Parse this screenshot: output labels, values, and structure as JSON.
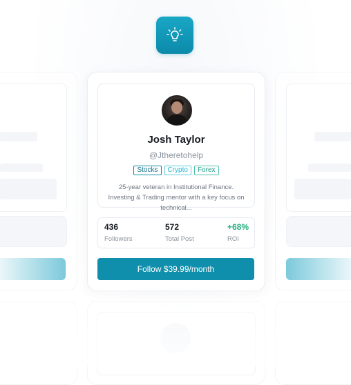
{
  "app": {
    "logo_icon": "lightbulb-icon",
    "accent_color": "#0f8fab"
  },
  "profile": {
    "name": "Josh Taylor",
    "handle": "@Jtheretohelp",
    "avatar_icon": "avatar-photo",
    "tags": [
      "Stocks",
      "Crypto",
      "Forex"
    ],
    "bio": "25-year veteran in Institutional Finance. Investing & Trading mentor with a key focus on technical..."
  },
  "stats": [
    {
      "value": "436",
      "label": "Followers"
    },
    {
      "value": "572",
      "label": "Total Post"
    },
    {
      "value": "+68%",
      "label": "ROI",
      "color": "#22b07d"
    }
  ],
  "follow_button": {
    "label": "Follow $39.99/month"
  }
}
